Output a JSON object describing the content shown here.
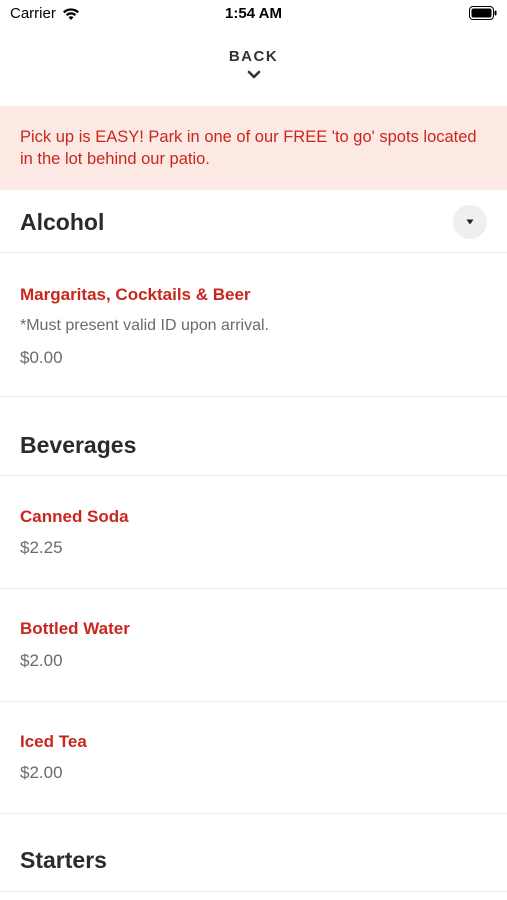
{
  "status_bar": {
    "carrier": "Carrier",
    "time": "1:54 AM"
  },
  "nav": {
    "back_label": "BACK"
  },
  "banner": {
    "text": "Pick up is EASY! Park in one of our FREE 'to go' spots located in the lot behind our patio."
  },
  "sections": [
    {
      "title": "Alcohol",
      "items": [
        {
          "name": "Margaritas, Cocktails & Beer",
          "description": "*Must present valid ID upon arrival.",
          "price": "$0.00"
        }
      ]
    },
    {
      "title": "Beverages",
      "items": [
        {
          "name": "Canned Soda",
          "price": "$2.25"
        },
        {
          "name": "Bottled Water",
          "price": "$2.00"
        },
        {
          "name": "Iced Tea",
          "price": "$2.00"
        }
      ]
    },
    {
      "title": "Starters",
      "items": []
    }
  ],
  "colors": {
    "accent": "#c9271e",
    "banner_bg": "#fde9e4",
    "muted_text": "#6b6b6b",
    "divider": "#ececec"
  },
  "icons": {
    "wifi": "wifi-icon",
    "battery": "battery-icon",
    "back": "chevron-down-icon",
    "dropdown": "caret-down-icon"
  }
}
